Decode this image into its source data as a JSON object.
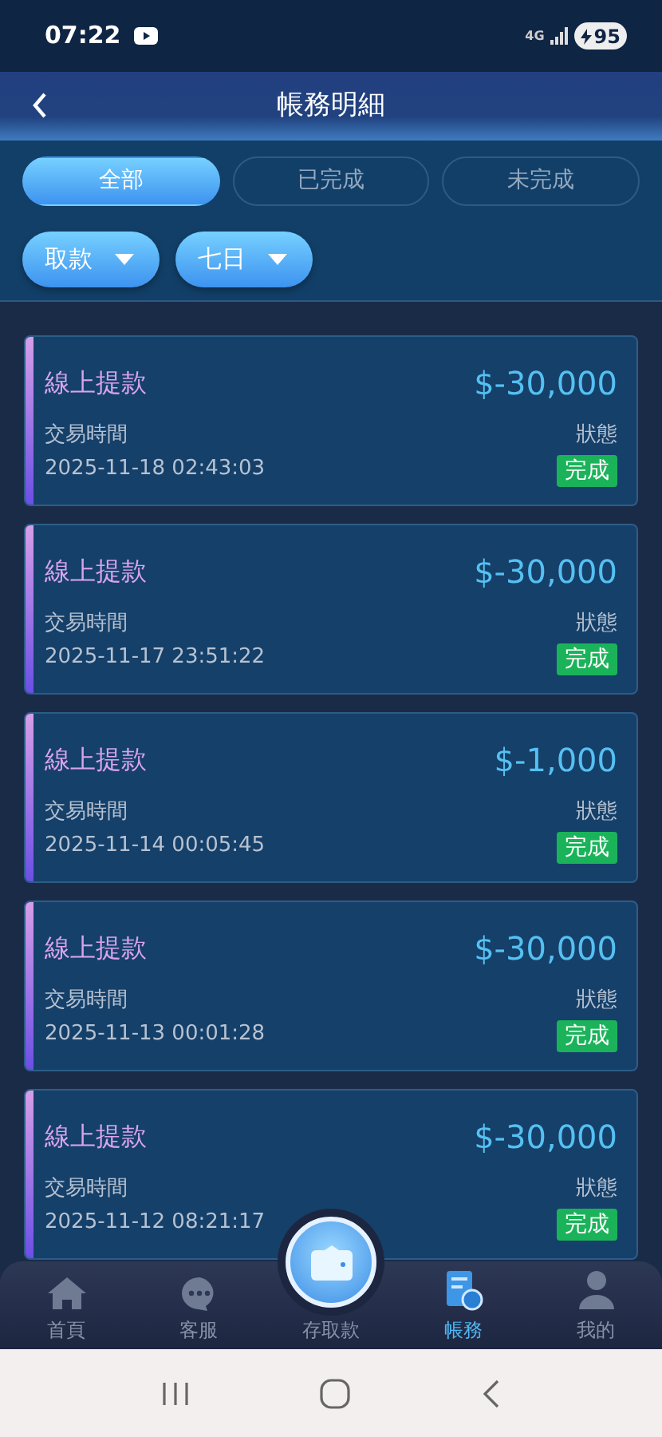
{
  "status_bar": {
    "time": "07:22",
    "network": "4G",
    "battery": "95"
  },
  "header": {
    "title": "帳務明細"
  },
  "status_tabs": [
    {
      "label": "全部",
      "selected": true
    },
    {
      "label": "已完成",
      "selected": false
    },
    {
      "label": "未完成",
      "selected": false
    }
  ],
  "filters": [
    {
      "label": "取款"
    },
    {
      "label": "七日"
    }
  ],
  "transactions": [
    {
      "type": "線上提款",
      "amount": "$-30,000",
      "time_label": "交易時間",
      "time": "2025-11-18 02:43:03",
      "status_label": "狀態",
      "status": "完成"
    },
    {
      "type": "線上提款",
      "amount": "$-30,000",
      "time_label": "交易時間",
      "time": "2025-11-17 23:51:22",
      "status_label": "狀態",
      "status": "完成"
    },
    {
      "type": "線上提款",
      "amount": "$-1,000",
      "time_label": "交易時間",
      "time": "2025-11-14 00:05:45",
      "status_label": "狀態",
      "status": "完成"
    },
    {
      "type": "線上提款",
      "amount": "$-30,000",
      "time_label": "交易時間",
      "time": "2025-11-13 00:01:28",
      "status_label": "狀態",
      "status": "完成"
    },
    {
      "type": "線上提款",
      "amount": "$-30,000",
      "time_label": "交易時間",
      "time": "2025-11-12 08:21:17",
      "status_label": "狀態",
      "status": "完成"
    }
  ],
  "bottom_nav": [
    {
      "label": "首頁",
      "kind": "home",
      "selected": false
    },
    {
      "label": "客服",
      "kind": "chat",
      "selected": false
    },
    {
      "label": "存取款",
      "kind": "wallet",
      "selected": false
    },
    {
      "label": "帳務",
      "kind": "ledger",
      "selected": true
    },
    {
      "label": "我的",
      "kind": "person",
      "selected": false
    }
  ]
}
